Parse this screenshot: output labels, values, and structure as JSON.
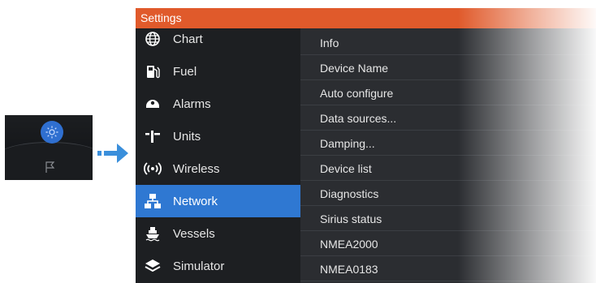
{
  "window": {
    "title": "Settings",
    "accent": "#e05a2b",
    "selection_color": "#2f78d2"
  },
  "thumbnail": {
    "icons": [
      "gear-icon",
      "flag-icon"
    ]
  },
  "left_menu": [
    {
      "label": "Chart",
      "icon": "globe-icon"
    },
    {
      "label": "Fuel",
      "icon": "fuel-pump-icon"
    },
    {
      "label": "Alarms",
      "icon": "alarm-icon"
    },
    {
      "label": "Units",
      "icon": "units-icon"
    },
    {
      "label": "Wireless",
      "icon": "wireless-icon"
    },
    {
      "label": "Network",
      "icon": "network-icon",
      "selected": true
    },
    {
      "label": "Vessels",
      "icon": "vessel-icon"
    },
    {
      "label": "Simulator",
      "icon": "simulator-icon"
    }
  ],
  "right_list": [
    {
      "label": "Info"
    },
    {
      "label": "Device Name"
    },
    {
      "label": "Auto configure"
    },
    {
      "label": "Data sources..."
    },
    {
      "label": "Damping..."
    },
    {
      "label": "Device list"
    },
    {
      "label": "Diagnostics"
    },
    {
      "label": "Sirius status"
    },
    {
      "label": "NMEA2000"
    },
    {
      "label": "NMEA0183"
    }
  ]
}
